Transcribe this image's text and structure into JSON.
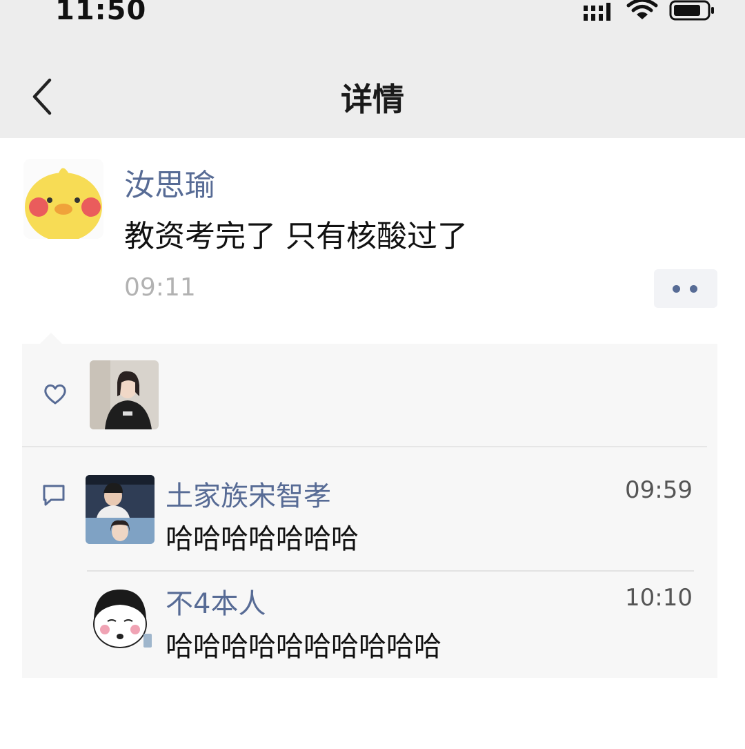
{
  "status_bar": {
    "time": "11:50",
    "icons": [
      "signal-icon",
      "wifi-icon",
      "battery-icon"
    ]
  },
  "nav": {
    "back_icon": "chevron-left-icon",
    "title": "详情"
  },
  "post": {
    "author": "汝思瑜",
    "avatar": "yellow-duck-avatar",
    "text": "教资考完了 只有核酸过了",
    "time": "09:11",
    "more_icon": "more-dots-icon"
  },
  "likes": {
    "icon": "heart-icon",
    "avatars": [
      "girl-photo-avatar"
    ]
  },
  "comments": {
    "icon": "comment-icon",
    "items": [
      {
        "name": "土家族宋智孝",
        "time": "09:59",
        "text": "哈哈哈哈哈哈哈",
        "avatar": "couple-photo-avatar"
      },
      {
        "name": "不4本人",
        "time": "10:10",
        "text": "哈哈哈哈哈哈哈哈哈哈",
        "avatar": "meme-face-avatar"
      }
    ]
  },
  "colors": {
    "link": "#576b95",
    "bar_background": "#ededed",
    "panel_background": "#f7f7f7",
    "time_gray": "#b2b2b2"
  }
}
